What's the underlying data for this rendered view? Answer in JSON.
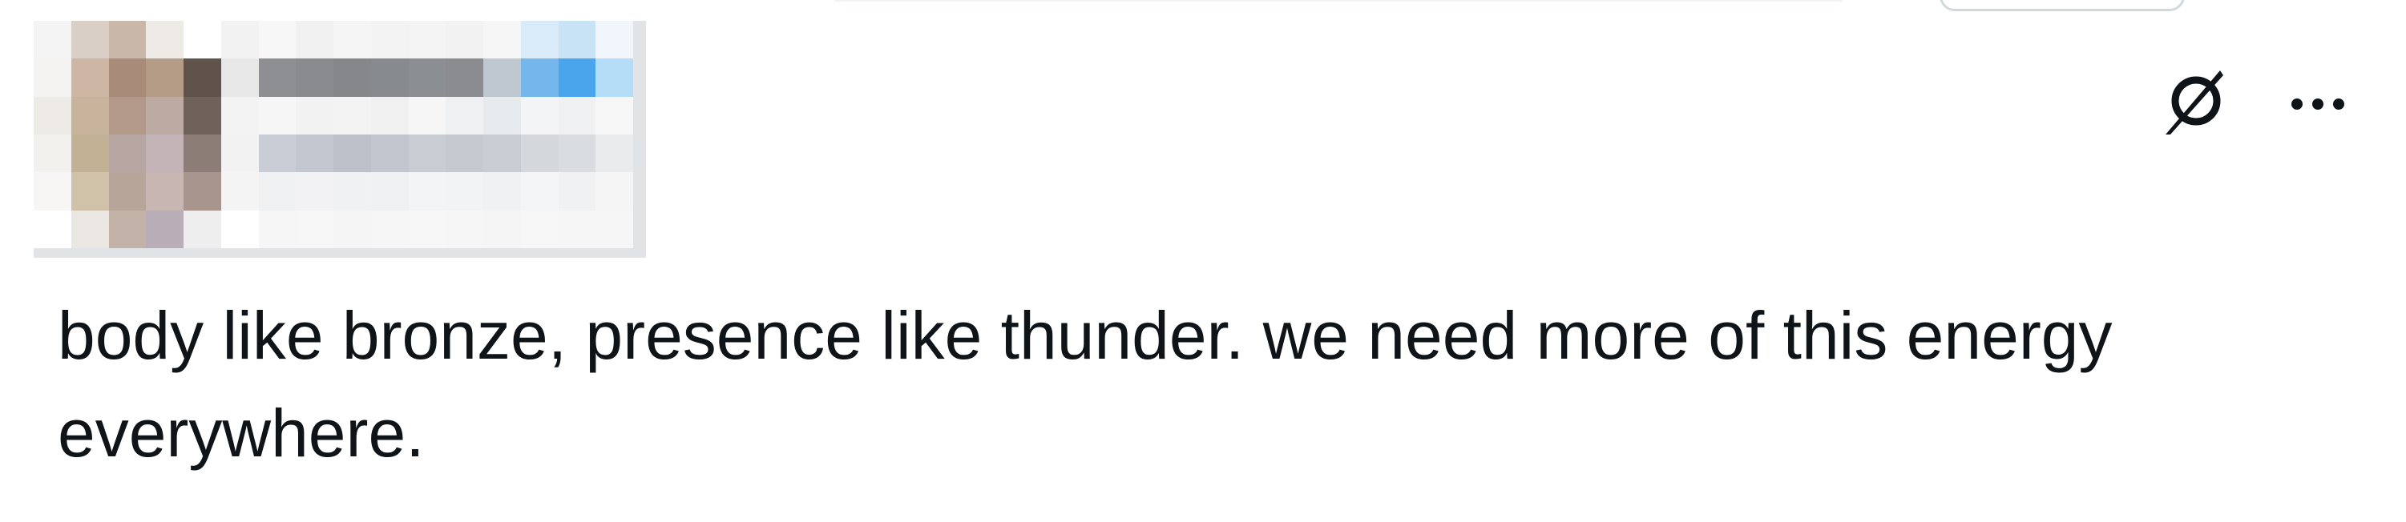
{
  "post": {
    "text": "body like bronze, presence like thunder. we need more of this energy everywhere.",
    "author_header_redacted": true
  },
  "actions": {
    "grok_icon": "grok-slash-circle-icon",
    "more_icon": "more-horizontal-icon"
  },
  "colors": {
    "text": "#0f1419",
    "icon": "#0f1419",
    "border": "#cfd9de",
    "accent_blue": "#1d9bf0"
  },
  "redaction_pixels": [
    [
      "#f4f4f4",
      "#d9cfc7",
      "#c9b8aa",
      "#eeeae6",
      "#ffffff",
      "#f2f2f2",
      "#f7f7f7",
      "#f1f1f1",
      "#f5f5f5",
      "#f3f3f3",
      "#f4f4f4",
      "#f2f2f2",
      "#f6f6f6",
      "#d9ebf8",
      "#c9e3f6",
      "#f0f6fb"
    ],
    [
      "#f5f3f1",
      "#cdb6a4",
      "#a88b78",
      "#b49c87",
      "#5f534b",
      "#e7e7e7",
      "#8e8f92",
      "#898b8f",
      "#85878b",
      "#878a8e",
      "#8b8e92",
      "#8a8c90",
      "#bfc8d1",
      "#76b7eb",
      "#4aa5ec",
      "#b6ddf8"
    ],
    [
      "#eeebe6",
      "#c8b49d",
      "#b3998a",
      "#bdaaa2",
      "#6e625a",
      "#f3f3f3",
      "#f6f6f7",
      "#f2f2f3",
      "#f3f3f4",
      "#f0f0f1",
      "#f6f6f7",
      "#eef0f2",
      "#e8ebee",
      "#f3f4f6",
      "#eff1f3",
      "#f7f7f8"
    ],
    [
      "#f3f1ee",
      "#c2b195",
      "#b8a6a2",
      "#c3b5b7",
      "#8c7d77",
      "#f2f2f2",
      "#c9ced6",
      "#c3c8d0",
      "#bdc2ca",
      "#c2c7cf",
      "#c8ccd3",
      "#c5c9d0",
      "#c8cdd3",
      "#d4d8dd",
      "#d9dce0",
      "#eaebed"
    ],
    [
      "#f7f6f4",
      "#cfc2a9",
      "#b8a59a",
      "#c7b6b2",
      "#a8958e",
      "#f4f4f4",
      "#eff0f2",
      "#f2f2f4",
      "#f0f1f3",
      "#eef0f2",
      "#f3f4f5",
      "#f2f3f5",
      "#eff1f3",
      "#f4f5f6",
      "#f0f1f3",
      "#f5f5f6"
    ],
    [
      "#ffffff",
      "#eae6e2",
      "#c3b2a8",
      "#b9adb7",
      "#efeeee",
      "#ffffff",
      "#f6f6f7",
      "#f7f7f8",
      "#f5f5f6",
      "#f6f6f7",
      "#f7f7f8",
      "#f6f6f7",
      "#f5f5f6",
      "#f7f7f8",
      "#f6f6f7",
      "#f6f6f7"
    ]
  ]
}
